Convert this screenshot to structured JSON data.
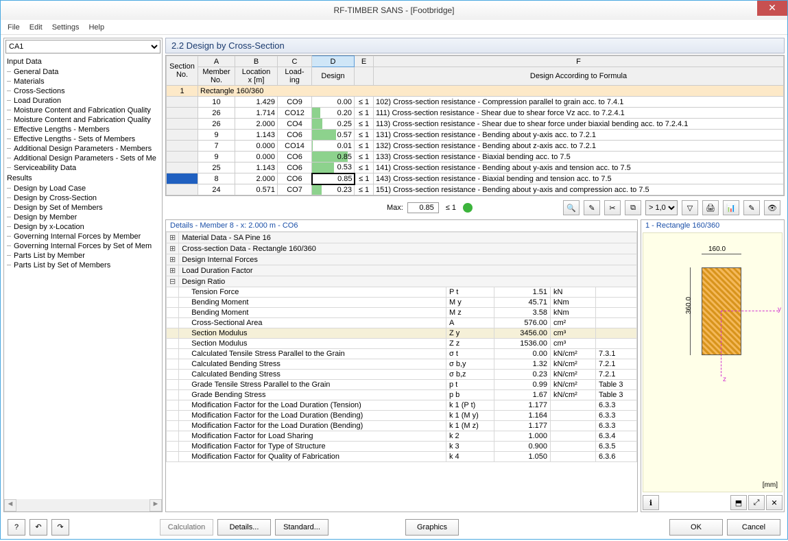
{
  "window": {
    "title": "RF-TIMBER SANS - [Footbridge]"
  },
  "menu": [
    "File",
    "Edit",
    "Settings",
    "Help"
  ],
  "case_select": "CA1",
  "tree": {
    "groups": [
      {
        "label": "Input Data",
        "items": [
          "General Data",
          "Materials",
          "Cross-Sections",
          "Load Duration",
          "Moisture Content and Fabrication Quality",
          "Moisture Content and Fabrication Quality",
          "Effective Lengths - Members",
          "Effective Lengths - Sets of Members",
          "Additional Design Parameters - Members",
          "Additional Design Parameters - Sets of Me",
          "Serviceability Data"
        ]
      },
      {
        "label": "Results",
        "items": [
          "Design by Load Case",
          "Design by Cross-Section",
          "Design by Set of Members",
          "Design by Member",
          "Design by x-Location",
          "Governing Internal Forces by Member",
          "Governing Internal Forces by Set of Mem",
          "Parts List by Member",
          "Parts List by Set of Members"
        ]
      }
    ]
  },
  "heading": "2.2  Design by Cross-Section",
  "columns": {
    "A": "A",
    "B": "B",
    "C": "C",
    "D": "D",
    "E": "E",
    "F": "F",
    "section": "Section",
    "no": "No.",
    "member": "Member",
    "memberno": "No.",
    "location": "Location",
    "xm": "x [m]",
    "load": "Load-",
    "ing": "ing",
    "design": "Design",
    "formula": "Design According to Formula"
  },
  "section_row": {
    "no": "1",
    "label": "Rectangle 160/360"
  },
  "rows": [
    {
      "member": "10",
      "x": "1.429",
      "load": "CO9",
      "design": "0.00",
      "le": "≤ 1",
      "desc": "102) Cross-section resistance - Compression parallel to grain acc. to 7.4.1",
      "bar": 0
    },
    {
      "member": "26",
      "x": "1.714",
      "load": "CO12",
      "design": "0.20",
      "le": "≤ 1",
      "desc": "111) Cross-section resistance - Shear due to shear force Vz acc. to 7.2.4.1",
      "bar": 20
    },
    {
      "member": "26",
      "x": "2.000",
      "load": "CO4",
      "design": "0.25",
      "le": "≤ 1",
      "desc": "113) Cross-section resistance - Shear due to shear force under biaxial bending acc. to 7.2.4.1",
      "bar": 25
    },
    {
      "member": "9",
      "x": "1.143",
      "load": "CO6",
      "design": "0.57",
      "le": "≤ 1",
      "desc": "131) Cross-section resistance - Bending about y-axis acc. to 7.2.1",
      "bar": 57
    },
    {
      "member": "7",
      "x": "0.000",
      "load": "CO14",
      "design": "0.01",
      "le": "≤ 1",
      "desc": "132) Cross-section resistance - Bending about z-axis acc. to 7.2.1",
      "bar": 1
    },
    {
      "member": "9",
      "x": "0.000",
      "load": "CO6",
      "design": "0.85",
      "le": "≤ 1",
      "desc": "133) Cross-section resistance - Biaxial bending acc. to 7.5",
      "bar": 85
    },
    {
      "member": "25",
      "x": "1.143",
      "load": "CO6",
      "design": "0.53",
      "le": "≤ 1",
      "desc": "141) Cross-section resistance - Bending about y-axis and tension acc. to 7.5",
      "bar": 53
    },
    {
      "member": "8",
      "x": "2.000",
      "load": "CO6",
      "design": "0.85",
      "le": "≤ 1",
      "desc": "143) Cross-section resistance - Biaxial bending and tension acc. to 7.5",
      "bar": 85,
      "selected": true
    },
    {
      "member": "24",
      "x": "0.571",
      "load": "CO7",
      "design": "0.23",
      "le": "≤ 1",
      "desc": "151) Cross-section resistance - Bending about y-axis and compression acc. to 7.5",
      "bar": 23
    }
  ],
  "maxrow": {
    "label": "Max:",
    "value": "0.85",
    "le": "≤ 1",
    "filter": "> 1,0"
  },
  "details": {
    "title": "Details - Member 8 - x: 2.000 m - CO6",
    "groups": [
      "Material Data - SA Pine 16",
      "Cross-section Data - Rectangle 160/360",
      "Design Internal Forces",
      "Load Duration Factor",
      "Design Ratio"
    ],
    "ratio_rows": [
      {
        "name": "Tension Force",
        "sym": "P t",
        "val": "1.51",
        "unit": "kN",
        "ref": ""
      },
      {
        "name": "Bending Moment",
        "sym": "M y",
        "val": "45.71",
        "unit": "kNm",
        "ref": ""
      },
      {
        "name": "Bending Moment",
        "sym": "M z",
        "val": "3.58",
        "unit": "kNm",
        "ref": ""
      },
      {
        "name": "Cross-Sectional Area",
        "sym": "A",
        "val": "576.00",
        "unit": "cm²",
        "ref": ""
      },
      {
        "name": "Section Modulus",
        "sym": "Z y",
        "val": "3456.00",
        "unit": "cm³",
        "ref": "",
        "hl": true
      },
      {
        "name": "Section Modulus",
        "sym": "Z z",
        "val": "1536.00",
        "unit": "cm³",
        "ref": ""
      },
      {
        "name": "Calculated Tensile Stress Parallel to the Grain",
        "sym": "σ t",
        "val": "0.00",
        "unit": "kN/cm²",
        "ref": "7.3.1"
      },
      {
        "name": "Calculated Bending Stress",
        "sym": "σ b,y",
        "val": "1.32",
        "unit": "kN/cm²",
        "ref": "7.2.1"
      },
      {
        "name": "Calculated Bending Stress",
        "sym": "σ b,z",
        "val": "0.23",
        "unit": "kN/cm²",
        "ref": "7.2.1"
      },
      {
        "name": "Grade Tensile Stress Parallel to the Grain",
        "sym": "p t",
        "val": "0.99",
        "unit": "kN/cm²",
        "ref": "Table 3"
      },
      {
        "name": "Grade Bending Stress",
        "sym": "p b",
        "val": "1.67",
        "unit": "kN/cm²",
        "ref": "Table 3"
      },
      {
        "name": "Modification Factor for the Load Duration (Tension)",
        "sym": "k 1 (P t)",
        "val": "1.177",
        "unit": "",
        "ref": "6.3.3"
      },
      {
        "name": "Modification Factor for the Load Duration (Bending)",
        "sym": "k 1 (M y)",
        "val": "1.164",
        "unit": "",
        "ref": "6.3.3"
      },
      {
        "name": "Modification Factor for the Load Duration (Bending)",
        "sym": "k 1 (M z)",
        "val": "1.177",
        "unit": "",
        "ref": "6.3.3"
      },
      {
        "name": "Modification Factor for Load Sharing",
        "sym": "k 2",
        "val": "1.000",
        "unit": "",
        "ref": "6.3.4"
      },
      {
        "name": "Modification Factor for Type of Structure",
        "sym": "k 3",
        "val": "0.900",
        "unit": "",
        "ref": "6.3.5"
      },
      {
        "name": "Modification Factor for Quality of Fabrication",
        "sym": "k 4",
        "val": "1.050",
        "unit": "",
        "ref": "6.3.6"
      }
    ]
  },
  "preview": {
    "title": "1 - Rectangle 160/360",
    "w": "160.0",
    "h": "360.0",
    "y": "y",
    "z": "z",
    "unit": "[mm]"
  },
  "footer": {
    "calc": "Calculation",
    "details": "Details...",
    "standard": "Standard...",
    "graphics": "Graphics",
    "ok": "OK",
    "cancel": "Cancel"
  }
}
